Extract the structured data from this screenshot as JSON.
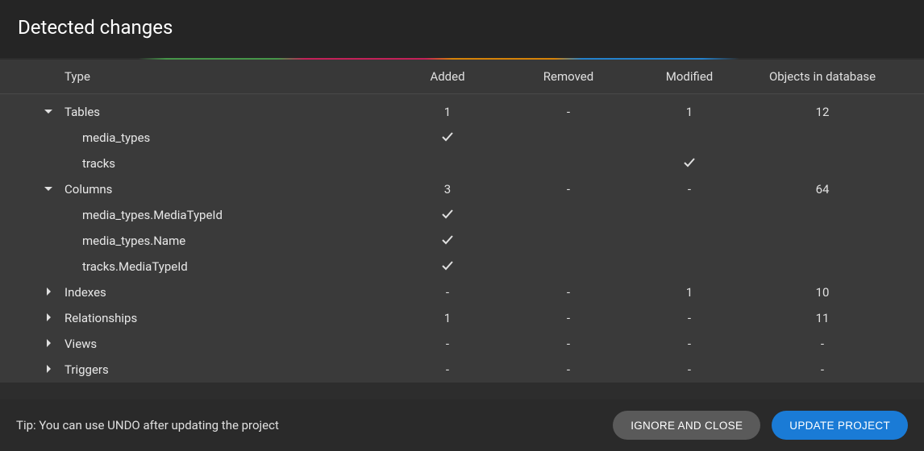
{
  "title": "Detected changes",
  "columns": {
    "type": "Type",
    "added": "Added",
    "removed": "Removed",
    "modified": "Modified",
    "objects": "Objects in database"
  },
  "rows": {
    "tables": {
      "name": "Tables",
      "added": "1",
      "removed": "-",
      "modified": "1",
      "objects": "12",
      "expanded": true
    },
    "tables_c1": {
      "name": "media_types",
      "added_tick": true
    },
    "tables_c2": {
      "name": "tracks",
      "modified_tick": true
    },
    "columns": {
      "name": "Columns",
      "added": "3",
      "removed": "-",
      "modified": "-",
      "objects": "64",
      "expanded": true
    },
    "columns_c1": {
      "name": "media_types.MediaTypeId",
      "added_tick": true
    },
    "columns_c2": {
      "name": "media_types.Name",
      "added_tick": true
    },
    "columns_c3": {
      "name": "tracks.MediaTypeId",
      "added_tick": true
    },
    "indexes": {
      "name": "Indexes",
      "added": "-",
      "removed": "-",
      "modified": "1",
      "objects": "10",
      "expanded": false
    },
    "relationships": {
      "name": "Relationships",
      "added": "1",
      "removed": "-",
      "modified": "-",
      "objects": "11",
      "expanded": false
    },
    "views": {
      "name": "Views",
      "added": "-",
      "removed": "-",
      "modified": "-",
      "objects": "-",
      "expanded": false
    },
    "triggers": {
      "name": "Triggers",
      "added": "-",
      "removed": "-",
      "modified": "-",
      "objects": "-",
      "expanded": false
    }
  },
  "footer": {
    "tip": "Tip: You can use UNDO after updating the project",
    "ignore": "IGNORE AND CLOSE",
    "update": "UPDATE PROJECT"
  }
}
